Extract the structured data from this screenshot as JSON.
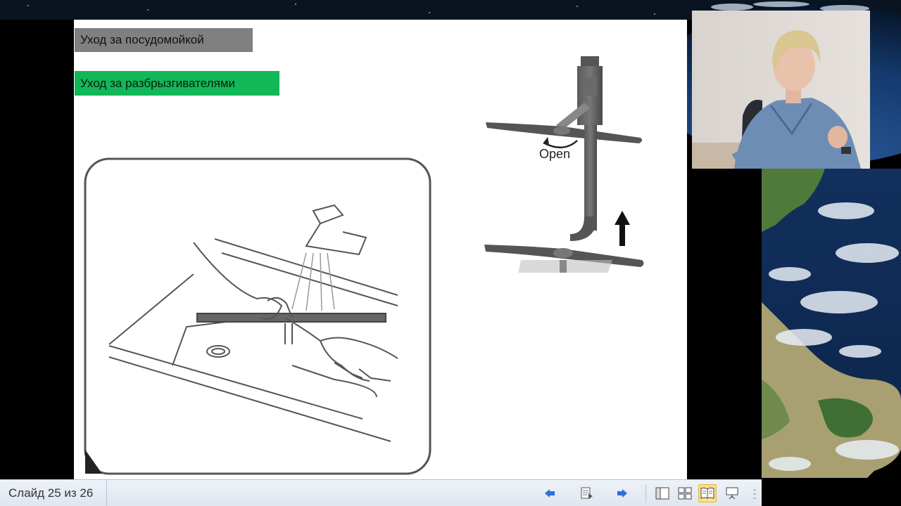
{
  "slide": {
    "heading_care_dishwasher": "Уход за посудомойкой",
    "heading_care_sprayers": "Уход за разбрызгивателями",
    "spray_arm_label": "Open"
  },
  "status_bar": {
    "slide_counter": "Слайд 25 из 26"
  },
  "icons": {
    "prev": "prev-slide-icon",
    "menu": "slide-menu-icon",
    "next": "next-slide-icon",
    "normal": "view-normal-icon",
    "sorter": "view-sorter-icon",
    "reading": "view-reading-icon",
    "slideshow": "view-slideshow-icon"
  },
  "colors": {
    "heading_gray": "#808080",
    "heading_green": "#12b858",
    "nav_arrow": "#2f6fd6",
    "active_view": "#fbe08a"
  }
}
